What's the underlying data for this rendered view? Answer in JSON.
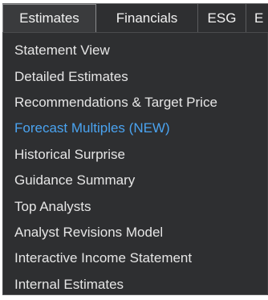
{
  "tabs": [
    {
      "label": "Estimates",
      "active": true
    },
    {
      "label": "Financials",
      "active": false
    },
    {
      "label": "ESG",
      "active": false
    },
    {
      "label": "E",
      "active": false
    }
  ],
  "menu": {
    "items": [
      {
        "label": "Statement View"
      },
      {
        "label": "Detailed Estimates"
      },
      {
        "label": "Recommendations & Target Price"
      },
      {
        "label": "Forecast Multiples (NEW)"
      },
      {
        "label": "Historical Surprise"
      },
      {
        "label": "Guidance Summary"
      },
      {
        "label": "Top Analysts"
      },
      {
        "label": "Analyst Revisions Model"
      },
      {
        "label": "Interactive Income Statement"
      },
      {
        "label": "Internal Estimates"
      }
    ]
  },
  "colors": {
    "background": "#2e2f31",
    "text": "#e6e6e6",
    "highlight_text": "#4aa3f0"
  }
}
